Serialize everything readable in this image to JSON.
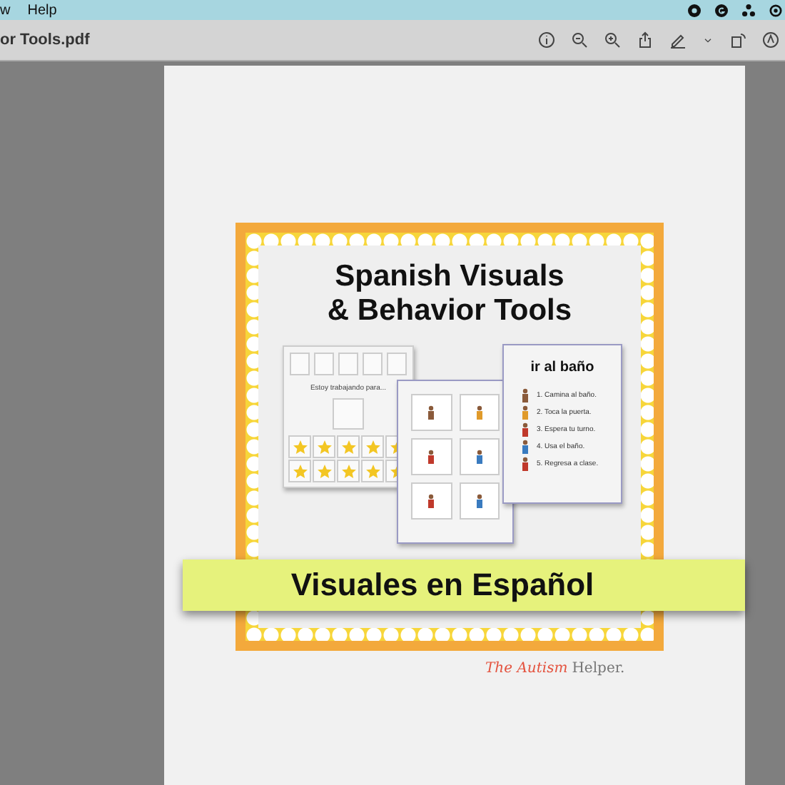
{
  "menu_bar": {
    "items": [
      "w",
      "Help"
    ]
  },
  "toolbar": {
    "title": "or Tools.pdf"
  },
  "document": {
    "title_lines": [
      "Spanish Visuals",
      "& Behavior Tools"
    ],
    "star_chart": {
      "heading": "Estoy trabajando para..."
    },
    "steps_sheet": {
      "title": "ir al baño",
      "steps": [
        "1. Camina al baño.",
        "2. Toca la puerta.",
        "3. Espera tu turno.",
        "4. Usa el baño.",
        "5. Regresa a clase."
      ]
    },
    "banner": "Visuales en Español",
    "logo": {
      "part_1": "The Autism",
      "part_2": "Helper."
    }
  }
}
